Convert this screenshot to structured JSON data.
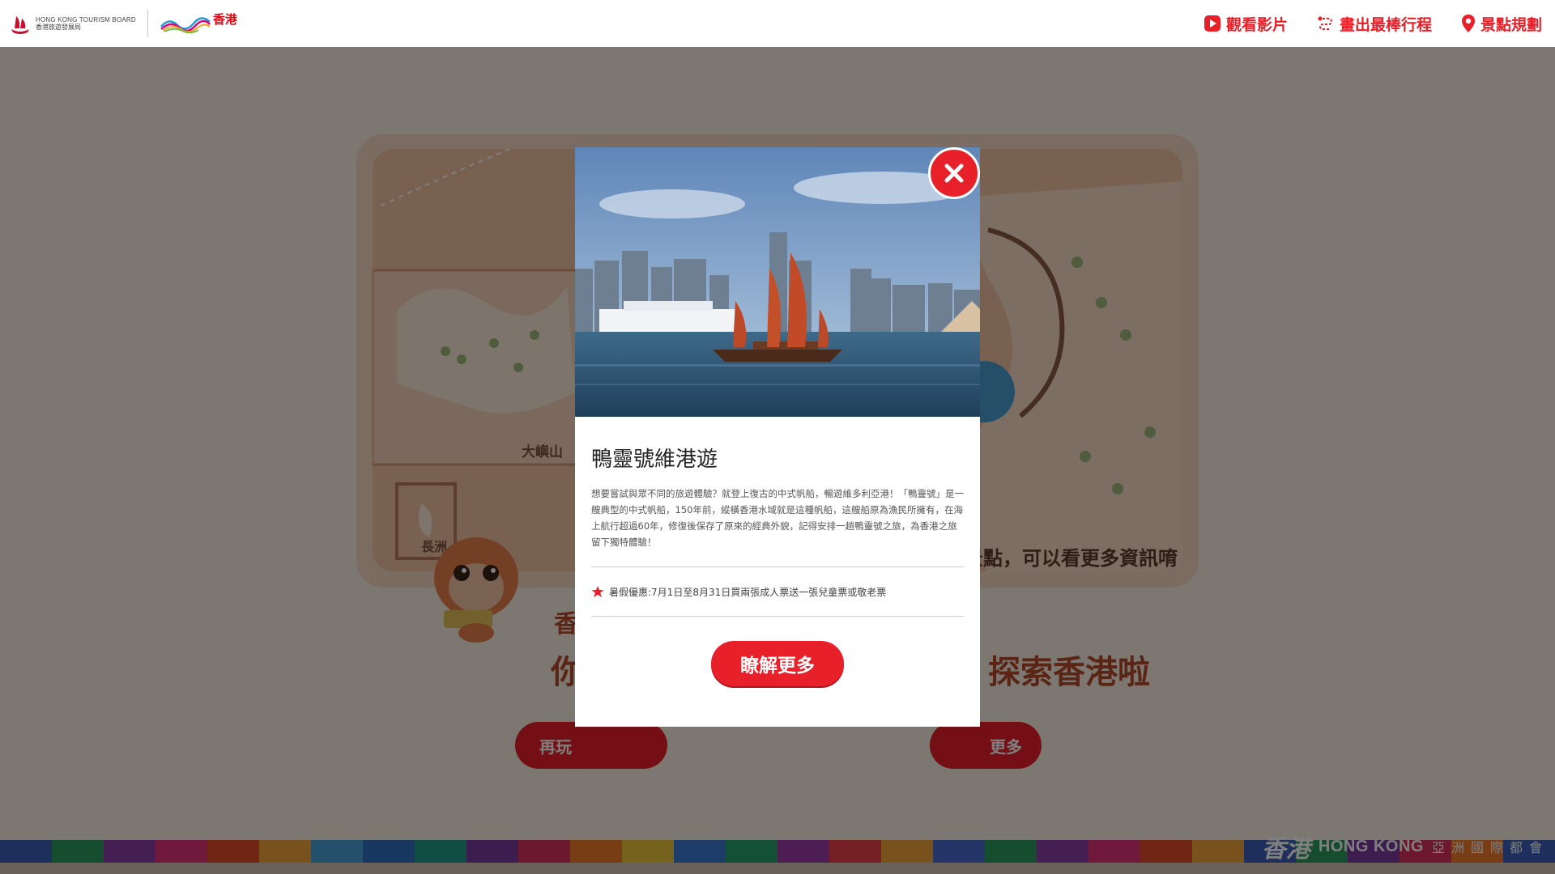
{
  "header": {
    "hktb_logo_en": "HONG KONG TOURISM BOARD",
    "hktb_logo_zh": "香港旅遊發展局",
    "brand_logo_zh": "香港",
    "nav": [
      {
        "label": "觀看影片",
        "icon": "play-icon"
      },
      {
        "label": "畫出最棒行程",
        "icon": "route-icon"
      },
      {
        "label": "景點規劃",
        "icon": "map-pin-icon"
      }
    ]
  },
  "background": {
    "map_label_lantau": "大嶼山",
    "map_label_cheung_chau": "長洲",
    "caption": "景點，可以看更多資訊唷",
    "title_line1": "香",
    "title_line2_left": "你",
    "title_line2_right": "探索香港啦",
    "button_left": "再玩",
    "button_right": "更多"
  },
  "modal": {
    "photo_alt": "Duk Ling junk sailing in Victoria Harbour",
    "title": "鴨靈號維港遊",
    "description": "想要嘗試與眾不同的旅遊體驗？就登上復古的中式帆船，暢遊維多利亞港！「鴨靈號」是一艘典型的中式帆船，150年前，縱橫香港水域就是這種帆船，這艘船原為漁民所擁有，在海上航行超過60年，修復後保存了原來的經典外貌，記得安排一趟鴨靈號之旅，為香港之旅留下獨特體驗！",
    "promo": "暑假優惠:7月1日至8月31日買兩張成人票送一張兒童票或敬老票",
    "button": "瞭解更多"
  },
  "footer": {
    "calligraphy": "香港",
    "brand_en": "HONG KONG",
    "brand_tagline": "亞洲國際都會"
  },
  "colors": {
    "accent": "#e8202a",
    "overlay": "rgba(0,0,0,0.5)"
  }
}
